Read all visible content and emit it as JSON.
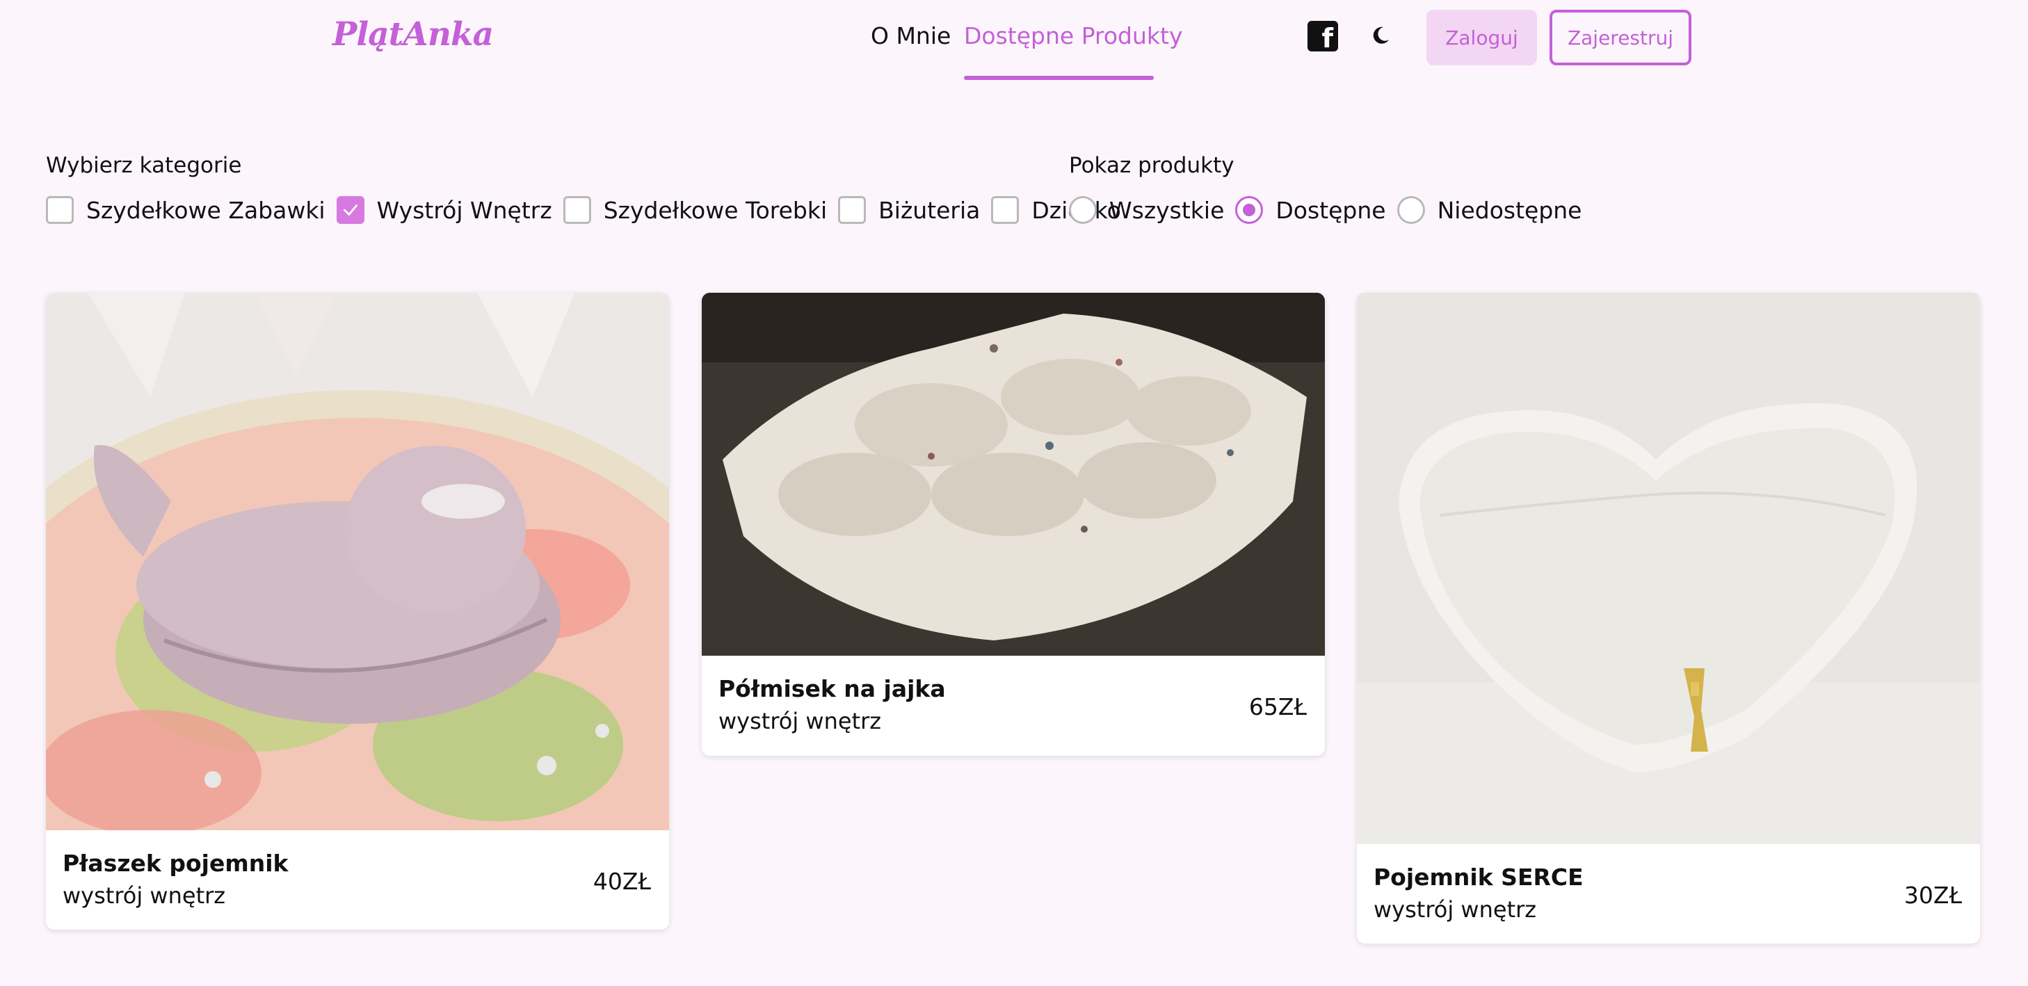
{
  "header": {
    "logo": "PlątAnka",
    "nav": {
      "about": "O Mnie",
      "products": "Dostępne Produkty"
    },
    "icons": {
      "facebook": "facebook-icon",
      "theme": "moon-icon"
    },
    "login_label": "Zaloguj",
    "register_label": "Zajerestruj"
  },
  "filters": {
    "category_heading": "Wybierz kategorie",
    "categories": [
      {
        "label": "Szydełkowe Zabawki",
        "checked": false
      },
      {
        "label": "Wystrój Wnętrz",
        "checked": true
      },
      {
        "label": "Szydełkowe Torebki",
        "checked": false
      },
      {
        "label": "Biżuteria",
        "checked": false
      },
      {
        "label": "Dziecko",
        "checked": false
      }
    ],
    "show_heading": "Pokaz produkty",
    "show_options": [
      {
        "label": "Wszystkie",
        "selected": false
      },
      {
        "label": "Dostępne",
        "selected": true
      },
      {
        "label": "Niedostępne",
        "selected": false
      }
    ]
  },
  "products": [
    {
      "title": "Płaszek pojemnik",
      "category": "wystrój wnętrz",
      "price": "40ZŁ"
    },
    {
      "title": "Półmisek na jajka",
      "category": "wystrój wnętrz",
      "price": "65ZŁ"
    },
    {
      "title": "Pojemnik SERCE",
      "category": "wystrój wnętrz",
      "price": "30ZŁ"
    }
  ],
  "colors": {
    "accent": "#c460d8",
    "accent_light": "#f3d6f3",
    "background": "#fcf6fc",
    "checkbox_checked": "#d77ae0"
  }
}
